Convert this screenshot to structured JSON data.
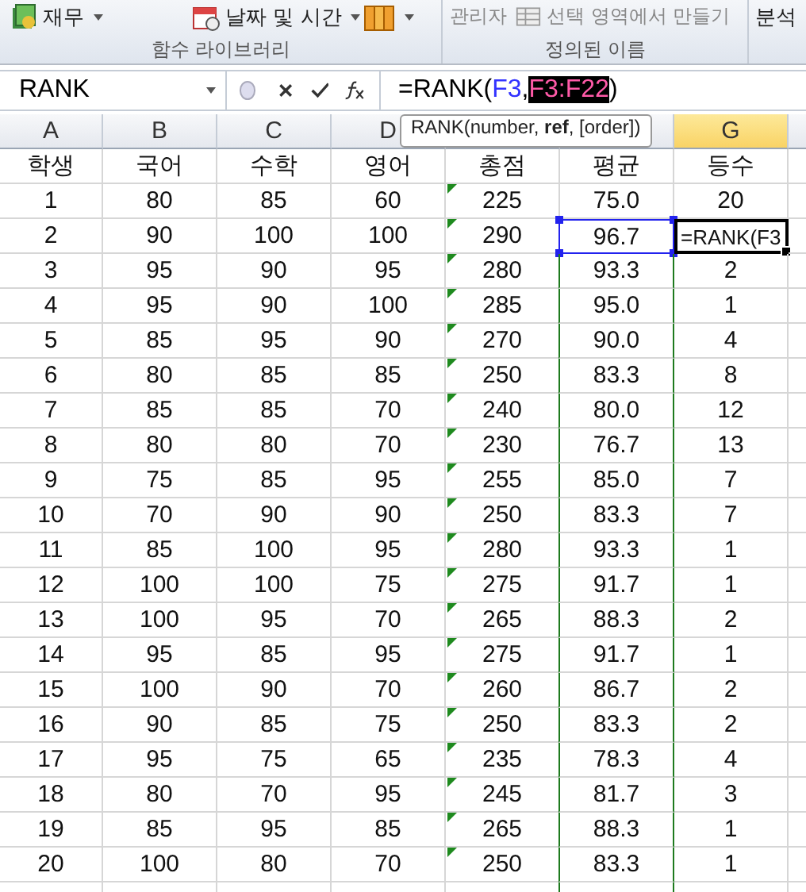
{
  "ribbon": {
    "groups": [
      {
        "label": "함수 라이브러리",
        "items": [
          {
            "label": "재무",
            "caret": true
          },
          {
            "label": "날짜 및 시간",
            "caret": true
          },
          {
            "caret": true
          }
        ]
      },
      {
        "label": "정의된 이름",
        "items": [
          {
            "label": "관리자",
            "caret": false
          },
          {
            "label": "선택 영역에서 만들기",
            "caret": false
          }
        ]
      },
      {
        "items": [
          {
            "label": "분석",
            "caret": false
          }
        ]
      }
    ]
  },
  "formula_bar": {
    "name_box": "RANK",
    "formula": [
      {
        "text": "=RANK(",
        "kind": "plain"
      },
      {
        "text": "F3",
        "kind": "ref"
      },
      {
        "text": ",",
        "kind": "plain"
      },
      {
        "text": "F3:F22",
        "kind": "selected"
      },
      {
        "text": ")",
        "kind": "plain"
      }
    ]
  },
  "tooltip": "RANK(number, **ref**, [order])",
  "columns": [
    {
      "label": "A",
      "selected": false
    },
    {
      "label": "B",
      "selected": false
    },
    {
      "label": "C",
      "selected": false
    },
    {
      "label": "D",
      "selected": false
    },
    {
      "selected": false
    },
    {
      "selected": false
    },
    {
      "label": "G",
      "selected": true
    }
  ],
  "rows": [
    {
      "cells": [
        "학생",
        "국어",
        "수학",
        "영어",
        "총점",
        "평균",
        "등수"
      ],
      "flag": false,
      "referenced": false,
      "in_range": false,
      "editing": false
    },
    {
      "cells": [
        "1",
        "80",
        "85",
        "60",
        "225",
        "75.0",
        "20"
      ],
      "flag": true,
      "referenced": false,
      "in_range": false,
      "editing": false
    },
    {
      "cells": [
        "2",
        "90",
        "100",
        "100",
        "290",
        "96.7",
        "=RANK(F3"
      ],
      "flag": true,
      "referenced": true,
      "editing": true
    },
    {
      "cells": [
        "3",
        "95",
        "90",
        "95",
        "280",
        "93.3",
        "2"
      ],
      "flag": true,
      "referenced": false,
      "in_range": true,
      "editing": false
    },
    {
      "cells": [
        "4",
        "95",
        "90",
        "100",
        "285",
        "95.0",
        "1"
      ],
      "flag": true,
      "referenced": false,
      "in_range": true,
      "editing": false
    },
    {
      "cells": [
        "5",
        "85",
        "95",
        "90",
        "270",
        "90.0",
        "4"
      ],
      "flag": true,
      "referenced": false,
      "in_range": true,
      "editing": false
    },
    {
      "cells": [
        "6",
        "80",
        "85",
        "85",
        "250",
        "83.3",
        "8"
      ],
      "flag": true,
      "referenced": false,
      "in_range": true,
      "editing": false
    },
    {
      "cells": [
        "7",
        "85",
        "85",
        "70",
        "240",
        "80.0",
        "12"
      ],
      "flag": true,
      "referenced": false,
      "in_range": true,
      "editing": false
    },
    {
      "cells": [
        "8",
        "80",
        "80",
        "70",
        "230",
        "76.7",
        "13"
      ],
      "flag": true,
      "referenced": false,
      "in_range": true,
      "editing": false
    },
    {
      "cells": [
        "9",
        "75",
        "85",
        "95",
        "255",
        "85.0",
        "7"
      ],
      "flag": true,
      "referenced": false,
      "in_range": true,
      "editing": false
    },
    {
      "cells": [
        "10",
        "70",
        "90",
        "90",
        "250",
        "83.3",
        "7"
      ],
      "flag": true,
      "referenced": false,
      "in_range": true,
      "editing": false
    },
    {
      "cells": [
        "11",
        "85",
        "100",
        "95",
        "280",
        "93.3",
        "1"
      ],
      "flag": true,
      "referenced": false,
      "in_range": true,
      "editing": false
    },
    {
      "cells": [
        "12",
        "100",
        "100",
        "75",
        "275",
        "91.7",
        "1"
      ],
      "flag": true,
      "referenced": false,
      "in_range": true,
      "editing": false
    },
    {
      "cells": [
        "13",
        "100",
        "95",
        "70",
        "265",
        "88.3",
        "2"
      ],
      "flag": true,
      "referenced": false,
      "in_range": true,
      "editing": false
    },
    {
      "cells": [
        "14",
        "95",
        "85",
        "95",
        "275",
        "91.7",
        "1"
      ],
      "flag": true,
      "referenced": false,
      "in_range": true,
      "editing": false
    },
    {
      "cells": [
        "15",
        "100",
        "90",
        "70",
        "260",
        "86.7",
        "2"
      ],
      "flag": true,
      "referenced": false,
      "in_range": true,
      "editing": false
    },
    {
      "cells": [
        "16",
        "90",
        "85",
        "75",
        "250",
        "83.3",
        "2"
      ],
      "flag": true,
      "referenced": false,
      "in_range": true,
      "editing": false
    },
    {
      "cells": [
        "17",
        "95",
        "75",
        "65",
        "235",
        "78.3",
        "4"
      ],
      "flag": true,
      "referenced": false,
      "in_range": true,
      "editing": false
    },
    {
      "cells": [
        "18",
        "80",
        "70",
        "95",
        "245",
        "81.7",
        "3"
      ],
      "flag": true,
      "referenced": false,
      "in_range": true,
      "editing": false
    },
    {
      "cells": [
        "19",
        "85",
        "95",
        "85",
        "265",
        "88.3",
        "1"
      ],
      "flag": true,
      "referenced": false,
      "in_range": true,
      "editing": false
    },
    {
      "cells": [
        "20",
        "100",
        "80",
        "70",
        "250",
        "83.3",
        "1"
      ],
      "flag": true,
      "referenced": false,
      "in_range": true,
      "editing": false
    }
  ]
}
